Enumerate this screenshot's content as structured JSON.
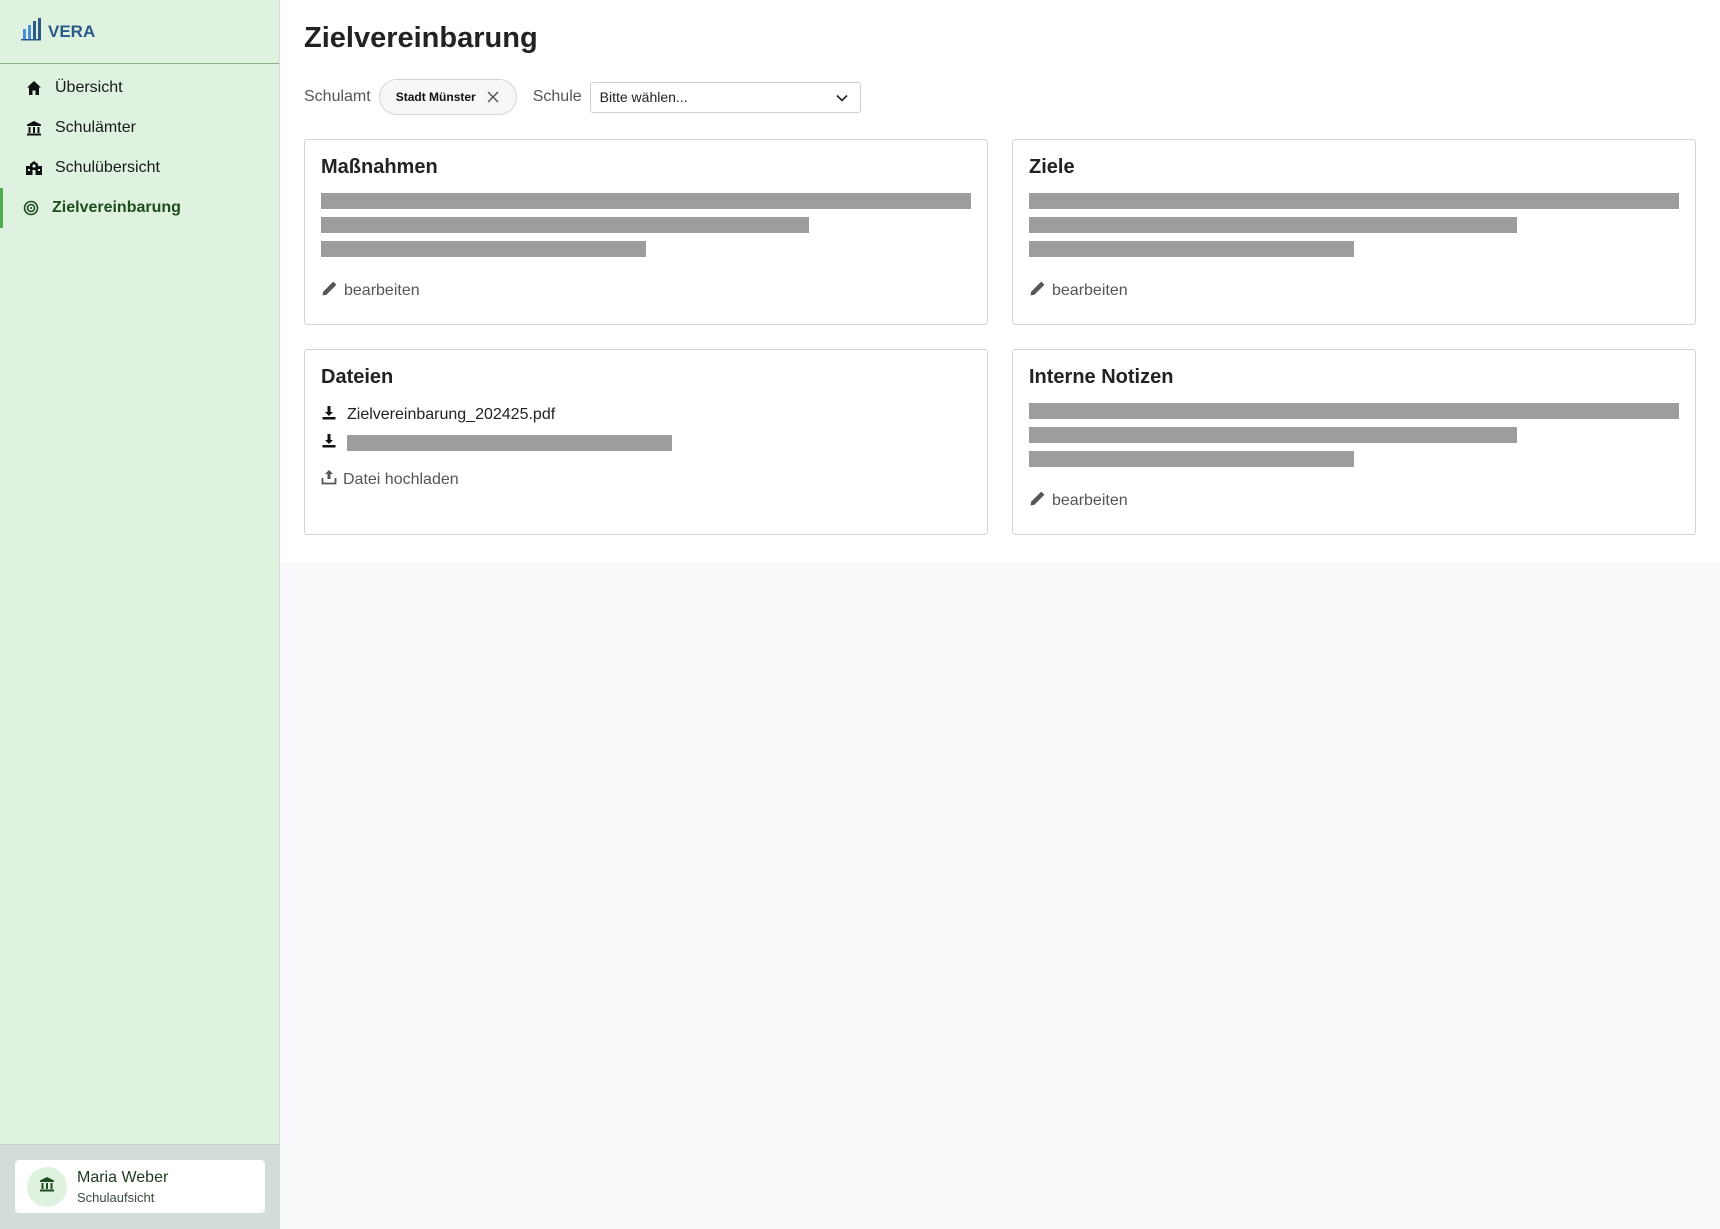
{
  "brand": {
    "name": "VERA"
  },
  "nav": {
    "items": [
      {
        "label": "Übersicht",
        "icon": "home-icon"
      },
      {
        "label": "Schulämter",
        "icon": "institution-icon"
      },
      {
        "label": "Schulübersicht",
        "icon": "school-icon"
      },
      {
        "label": "Zielvereinbarung",
        "icon": "target-icon",
        "active": true
      }
    ]
  },
  "user": {
    "name": "Maria Weber",
    "role": "Schulaufsicht"
  },
  "page": {
    "title": "Zielvereinbarung"
  },
  "filters": {
    "schulamt_label": "Schulamt",
    "schulamt_value": "Stadt Münster",
    "schule_label": "Schule",
    "schule_placeholder": "Bitte wählen..."
  },
  "cards": {
    "massnahmen": {
      "title": "Maßnahmen",
      "edit_label": "bearbeiten"
    },
    "ziele": {
      "title": "Ziele",
      "edit_label": "bearbeiten"
    },
    "dateien": {
      "title": "Dateien",
      "files": [
        "Zielvereinbarung_202425.pdf"
      ],
      "upload_label": "Datei hochladen"
    },
    "notizen": {
      "title": "Interne Notizen",
      "edit_label": "bearbeiten"
    }
  },
  "colors": {
    "sidebar_bg": "#dff1df",
    "accent": "#4caf50",
    "brand": "#2a5a8a",
    "skeleton": "#9d9d9d"
  }
}
